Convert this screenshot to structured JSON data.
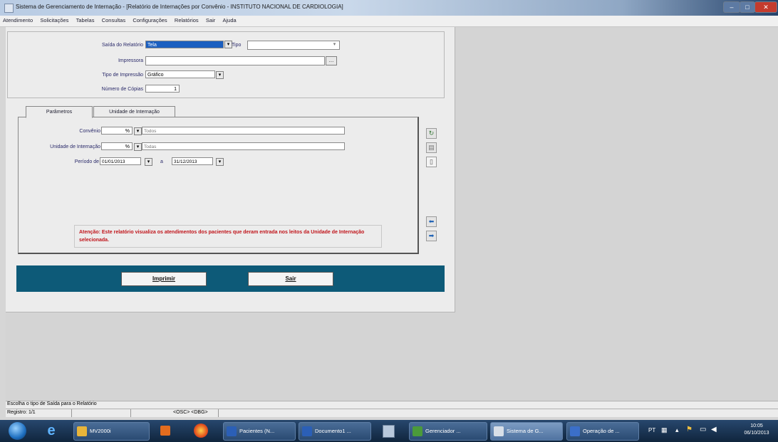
{
  "window": {
    "title": "Sistema de Gerenciamento de Internação - [Relatório de Internações por Convênio - INSTITUTO NACIONAL DE CARDIOLOGIA]"
  },
  "menu": [
    "Atendimento",
    "Solicitações",
    "Tabelas",
    "Consultas",
    "Configurações",
    "Relatórios",
    "Sair",
    "Ajuda"
  ],
  "form": {
    "saida_label": "Saída do Relatório",
    "saida_value": "Tela",
    "tipo_label": "Tipo",
    "tipo_value": "",
    "impressora_label": "Impressora",
    "impressora_value": "",
    "tipo_impressao_label": "Tipo de Impressão",
    "tipo_impressao_value": "Gráfico",
    "num_copias_label": "Número de Cópias",
    "num_copias_value": "1"
  },
  "tabs": [
    "Parâmetros",
    "Unidade de Internação"
  ],
  "params": {
    "convenio_label": "Convênio",
    "convenio_code": "%",
    "convenio_desc": "Todos",
    "unidade_label": "Unidade de Internação",
    "unidade_code": "%",
    "unidade_desc": "Todas",
    "periodo_label": "Período de",
    "date_from": "01/01/2013",
    "date_sep": "a",
    "date_to": "31/12/2013"
  },
  "warning": "Atenção: Este relatório visualiza os atendimentos dos pacientes que deram entrada nos leitos da Unidade de Internação selecionada.",
  "buttons": {
    "print": "Imprimir",
    "exit": "Sair"
  },
  "statusbar": {
    "hint": "Escolha o tipo de Saída para o Relatório",
    "record": "Registro: 1/1",
    "flags": "<OSC> <DBG>"
  },
  "taskbar": {
    "items": [
      "MV2000i",
      "Pacientes (N...",
      "Documento1 ...",
      "Gerenciador ...",
      "Sistema de G...",
      "Operação de ..."
    ],
    "lang": "PT",
    "time": "10:05",
    "date": "06/10/2013"
  },
  "colors": {
    "actionbar": "#0d5a78",
    "warning": "#c0141a",
    "taskbar": "#1b3656"
  }
}
